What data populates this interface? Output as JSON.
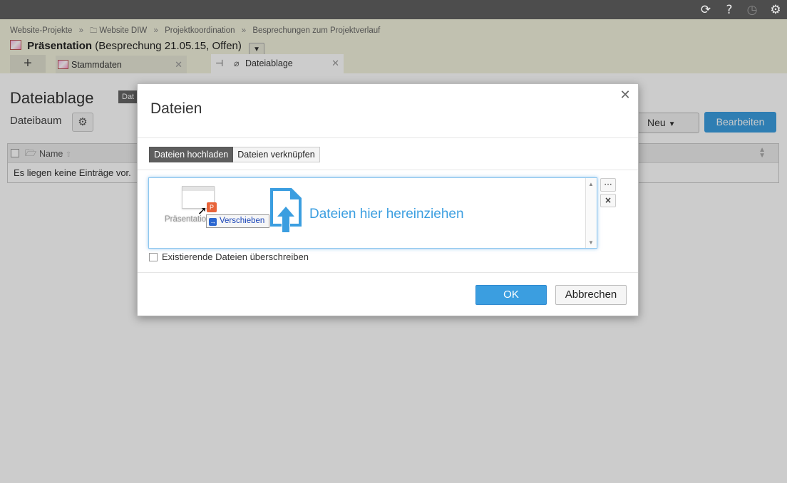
{
  "topbar": {
    "icons": [
      "sync-icon",
      "help-icon",
      "timer-icon",
      "gear-icon"
    ],
    "help_glyph": "?"
  },
  "breadcrumb": {
    "items": [
      "Website-Projekte",
      "Website DIW",
      "Projektkoordination",
      "Besprechungen zum Projektverlauf"
    ],
    "separator": "»"
  },
  "title": {
    "main": "Präsentation",
    "sub": "(Besprechung 21.05.15, Offen)"
  },
  "tabs": [
    {
      "label": "Stammdaten",
      "active": false
    },
    {
      "label": "Dateiablage",
      "active": true
    }
  ],
  "page": {
    "title": "Dateiablage",
    "badge": "Dat",
    "subtitle": "Dateibaum",
    "neu_label": "Neu",
    "bearbeiten_label": "Bearbeiten",
    "grid": {
      "column_name": "Name",
      "empty_text": "Es liegen keine Einträge vor."
    }
  },
  "dialog": {
    "title": "Dateien",
    "segments": [
      "Dateien hochladen",
      "Dateien verknüpfen"
    ],
    "active_segment": 0,
    "dropzone": {
      "file_name": "Präsentation",
      "drag_action": "Verschieben",
      "hint": "Dateien hier hereinziehen"
    },
    "side_buttons": [
      "···",
      "×"
    ],
    "overwrite_label": "Existierende Dateien überschreiben",
    "overwrite_checked": false,
    "ok_label": "OK",
    "cancel_label": "Abbrechen"
  },
  "colors": {
    "accent": "#3b9ee0",
    "header_bg": "#f2f2dd",
    "topbar_bg": "#4d4d4d"
  }
}
